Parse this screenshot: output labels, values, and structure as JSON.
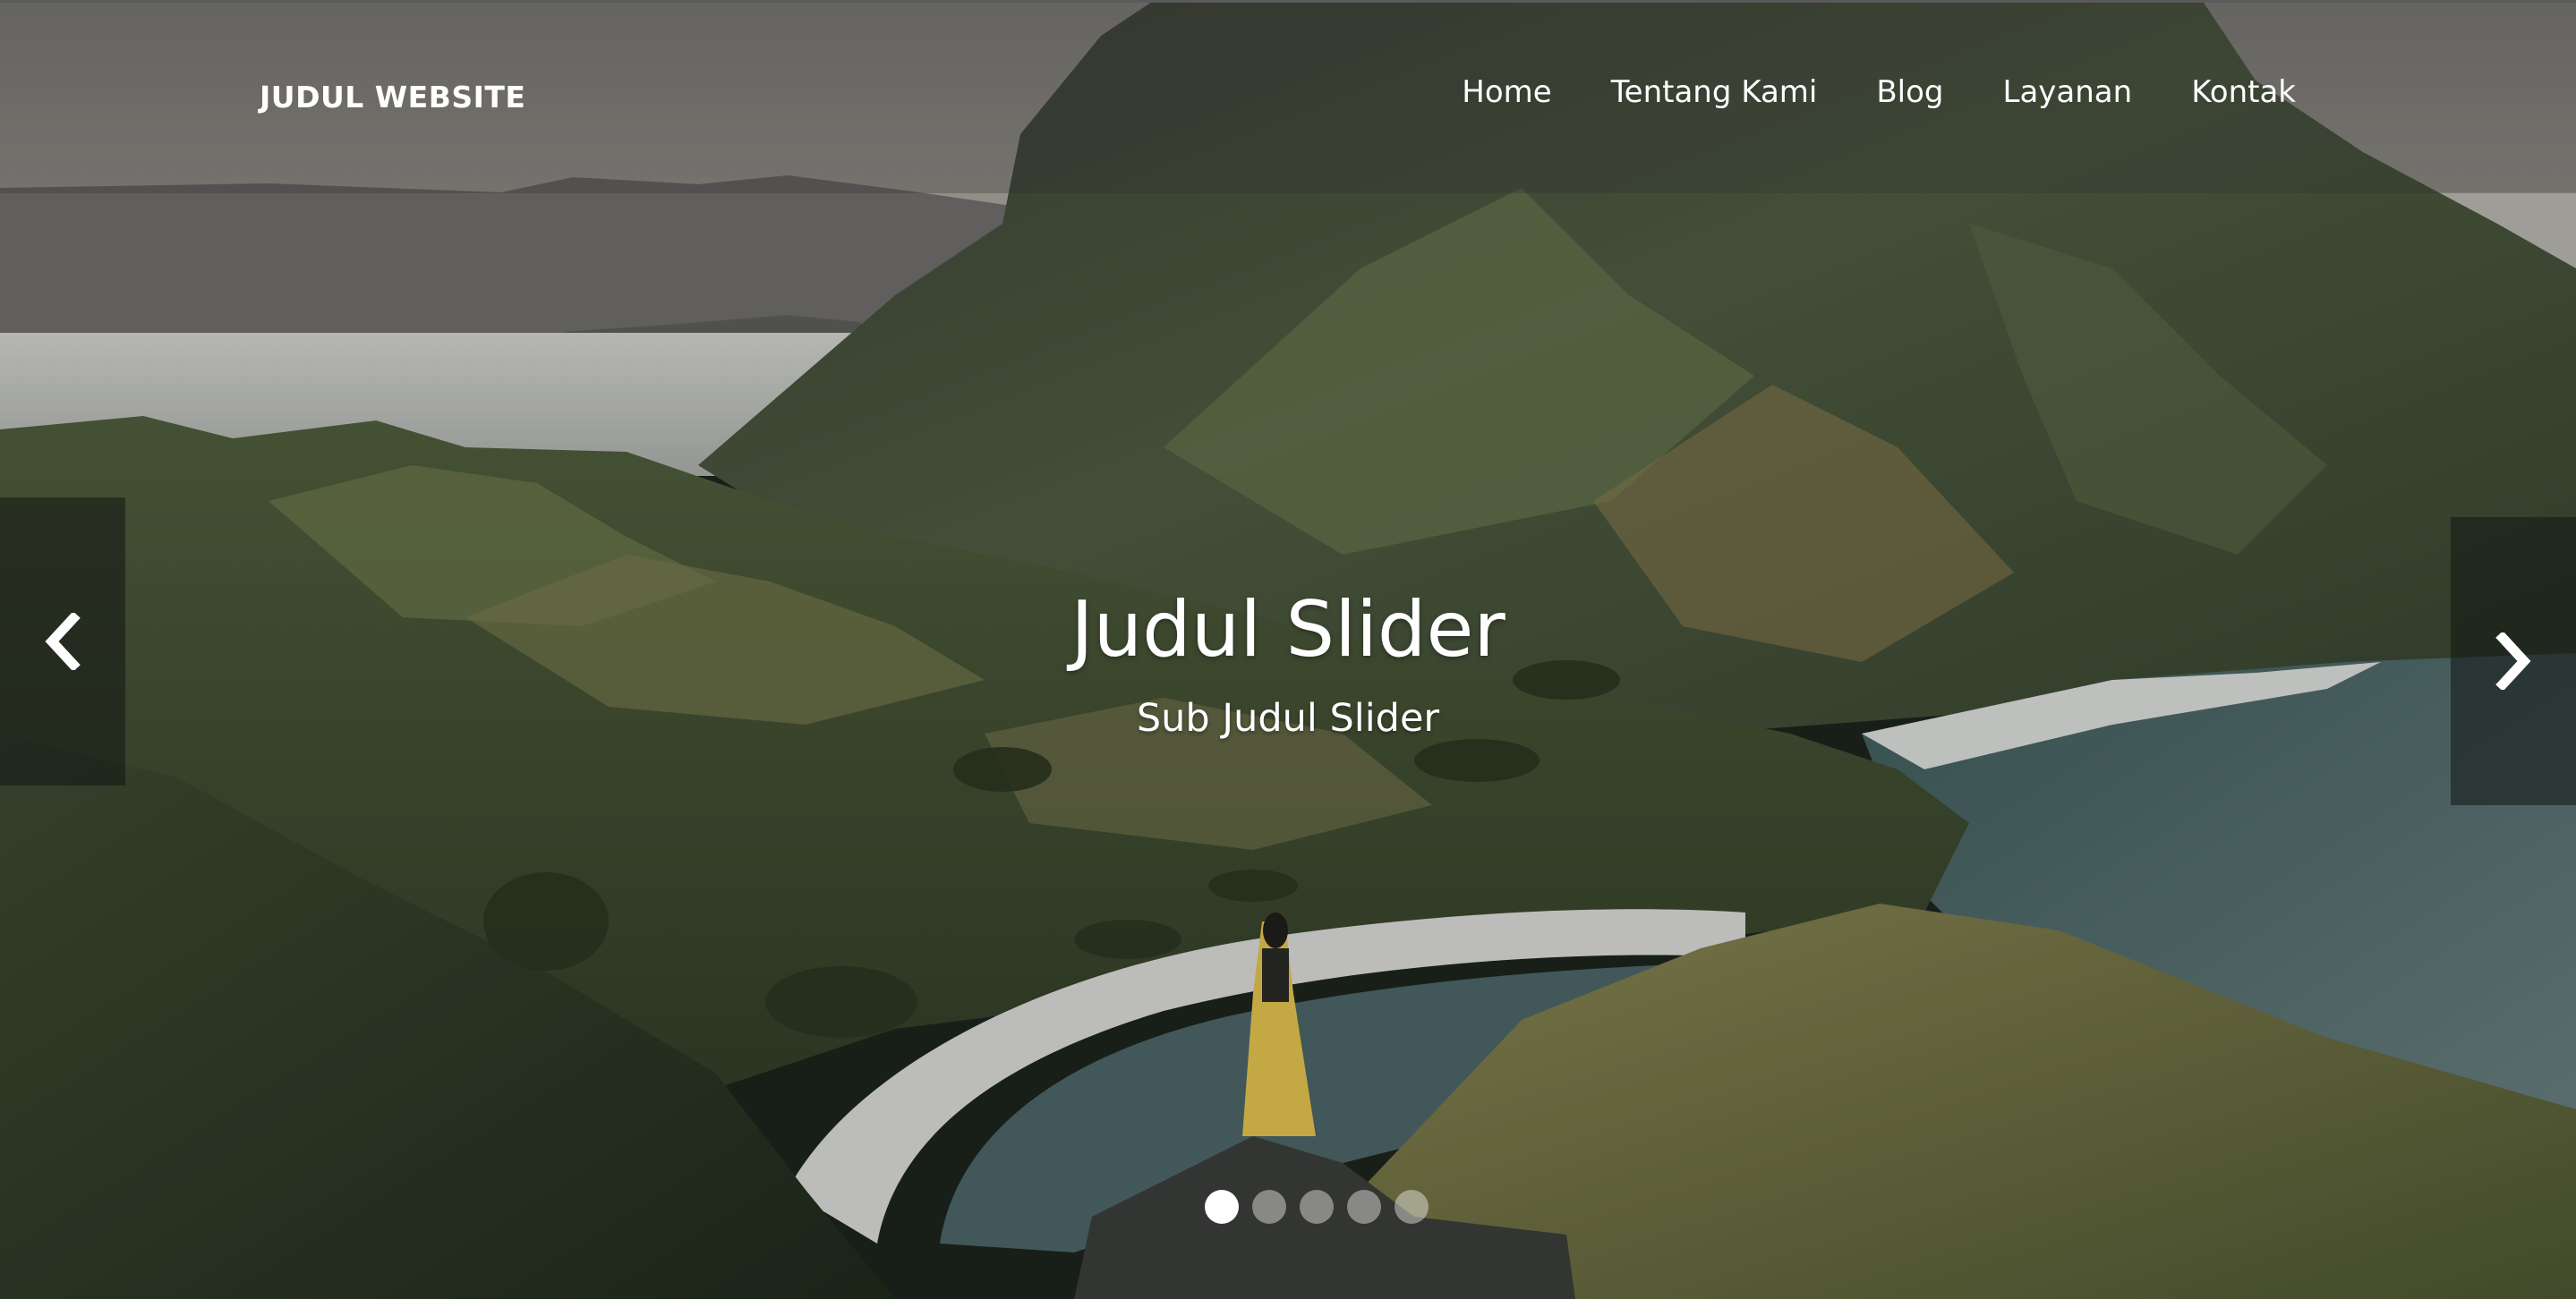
{
  "brand": "JUDUL WEBSITE",
  "nav": [
    {
      "label": "Home"
    },
    {
      "label": "Tentang Kami"
    },
    {
      "label": "Blog"
    },
    {
      "label": "Layanan"
    },
    {
      "label": "Kontak"
    }
  ],
  "slider": {
    "title": "Judul Slider",
    "subtitle": "Sub Judul Slider",
    "slide_count": 5,
    "active_index": 0,
    "icons": {
      "prev": "chevron-left-icon",
      "next": "chevron-right-icon"
    }
  },
  "colors": {
    "text": "#ffffff",
    "navbar_overlay": "rgba(48,48,48,0.28)",
    "control_bg": "rgba(18,22,20,0.55)",
    "indicator_inactive": "rgba(255,255,255,0.42)",
    "indicator_active": "#ffffff"
  }
}
